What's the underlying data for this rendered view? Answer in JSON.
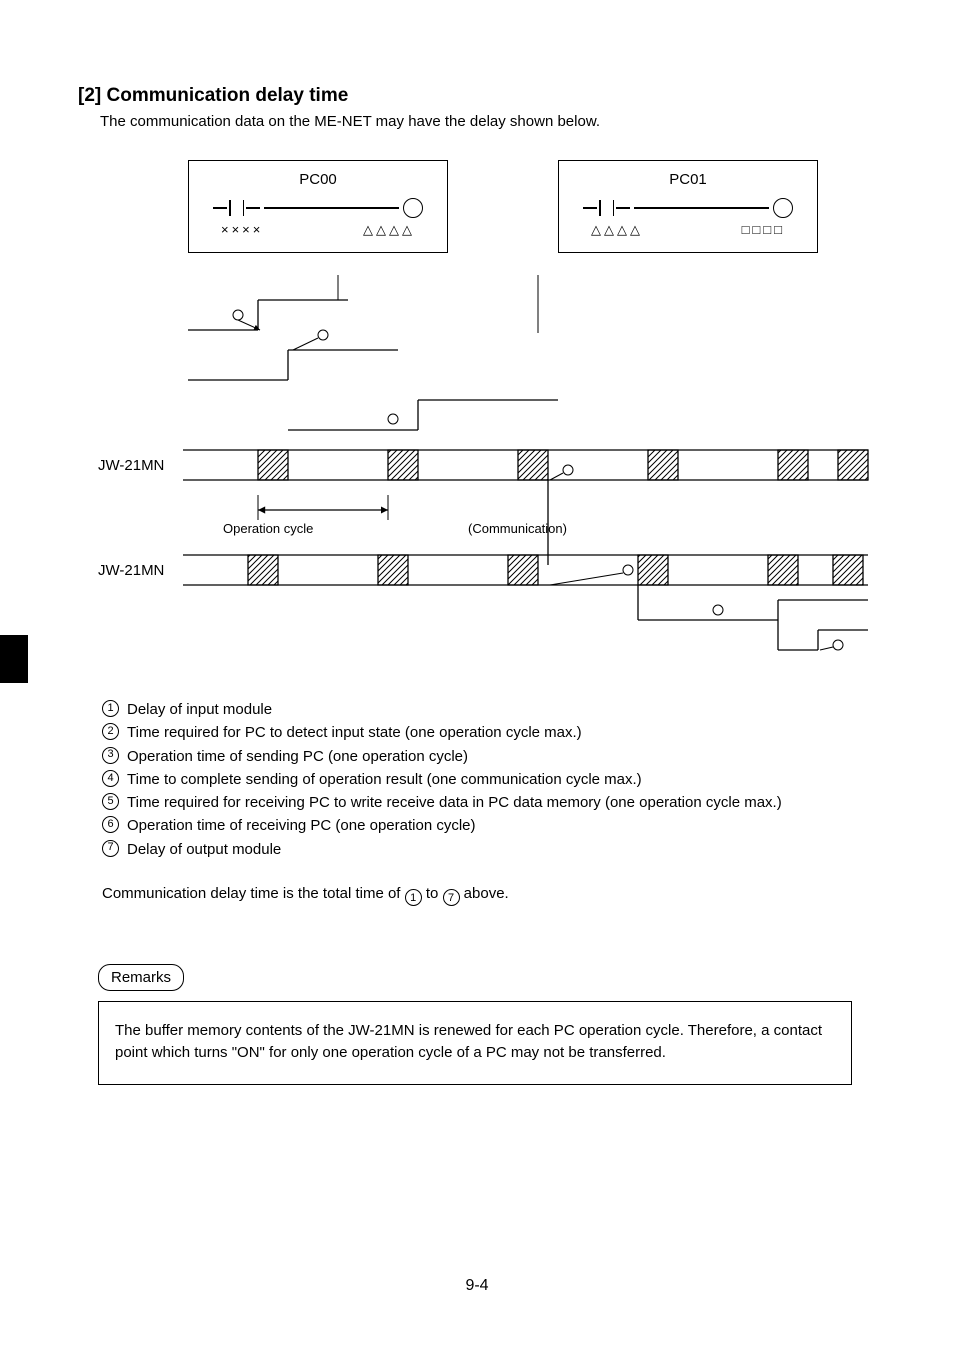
{
  "section": {
    "number": "[2]",
    "title": "Communication delay time",
    "intro": "The communication data on the ME-NET may have the delay shown below."
  },
  "ladders": [
    {
      "pc_label": "PC00",
      "symbol_left": "××××",
      "symbol_right": "△△△△"
    },
    {
      "pc_label": "PC01",
      "symbol_left": "△△△△",
      "symbol_right": "□□□□"
    }
  ],
  "timing": {
    "row1_label": "JW-21MN",
    "row2_label": "JW-21MN",
    "op_cycle_label": "Operation cycle",
    "communication_label": "(Communication)"
  },
  "delays": [
    "Delay of input module",
    "Time required for PC to detect input state (one operation cycle max.)",
    "Operation time of sending PC (one operation cycle)",
    "Time to complete sending of operation result (one communication cycle max.)",
    "Time required for receiving PC to write receive data in PC data memory (one operation cycle max.)",
    "Operation time of receiving PC (one operation cycle)",
    "Delay of output module"
  ],
  "summary": {
    "prefix": "Communication delay time is the total time of ",
    "from": "1",
    "mid": " to ",
    "to": "7",
    "suffix": " above."
  },
  "remarks": {
    "label": "Remarks",
    "text": "The buffer memory contents of the JW-21MN is renewed for each PC operation cycle. Therefore, a contact point which turns \"ON\" for only one operation cycle of a PC may not be transferred."
  },
  "page": "9-4"
}
